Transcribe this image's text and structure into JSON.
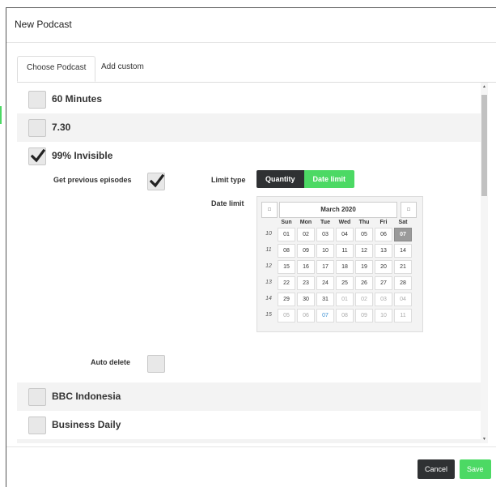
{
  "dialog": {
    "title": "New Podcast"
  },
  "tabs": [
    {
      "label": "Choose Podcast"
    },
    {
      "label": "Add custom"
    }
  ],
  "podcasts": [
    {
      "name": "60 Minutes",
      "checked": false
    },
    {
      "name": "7.30",
      "checked": false
    },
    {
      "name": "99% Invisible",
      "checked": true
    },
    {
      "name": "BBC Indonesia",
      "checked": false
    },
    {
      "name": "Business Daily",
      "checked": false
    }
  ],
  "options": {
    "get_previous_label": "Get previous episodes",
    "get_previous_checked": true,
    "limit_type_label": "Limit type",
    "limit_type_options": [
      "Quantity",
      "Date limit"
    ],
    "limit_type_selected": "Date limit",
    "date_limit_label": "Date limit",
    "auto_delete_label": "Auto delete",
    "auto_delete_checked": false
  },
  "calendar": {
    "month_label": "March 2020",
    "prev_icon": "□",
    "next_icon": "□",
    "weekdays": [
      "Sun",
      "Mon",
      "Tue",
      "Wed",
      "Thu",
      "Fri",
      "Sat"
    ],
    "weeks": [
      {
        "num": "10",
        "days": [
          "01",
          "02",
          "03",
          "04",
          "05",
          "06",
          "07"
        ]
      },
      {
        "num": "11",
        "days": [
          "08",
          "09",
          "10",
          "11",
          "12",
          "13",
          "14"
        ]
      },
      {
        "num": "12",
        "days": [
          "15",
          "16",
          "17",
          "18",
          "19",
          "20",
          "21"
        ]
      },
      {
        "num": "13",
        "days": [
          "22",
          "23",
          "24",
          "25",
          "26",
          "27",
          "28"
        ]
      },
      {
        "num": "14",
        "days": [
          "29",
          "30",
          "31",
          "01",
          "02",
          "03",
          "04"
        ]
      },
      {
        "num": "15",
        "days": [
          "05",
          "06",
          "07",
          "08",
          "09",
          "10",
          "11"
        ]
      }
    ],
    "selected": "07",
    "today_highlight": "07 (next month)"
  },
  "footer": {
    "cancel_label": "Cancel",
    "save_label": "Save"
  },
  "colors": {
    "accent_green": "#4cd964",
    "dark": "#2f3133",
    "selected_day": "#9a9a9a"
  }
}
